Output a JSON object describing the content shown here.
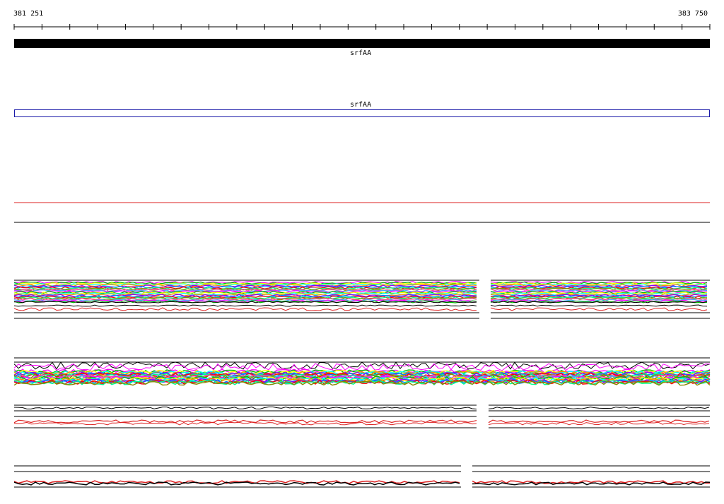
{
  "coordinates": {
    "start": "381 251",
    "end": "383 750"
  },
  "genes": [
    {
      "label": "srfAA",
      "track": "feature"
    },
    {
      "label": "srfAA",
      "track": "outline"
    }
  ],
  "colors": {
    "feature_bar": "#000000",
    "outline_box": "#1a1aa8",
    "red_line": "#dd2222",
    "axis": "#000000",
    "profile_palette": [
      "#ff00ff",
      "#00c000",
      "#ffff00",
      "#00ffff",
      "#ff8800",
      "#8800ff",
      "#0088ff",
      "#ff0000",
      "#00ff88",
      "#888800",
      "#ff44aa",
      "#44aaff"
    ]
  },
  "icons": {
    "gene_feature": "solid-black-bar",
    "gene_outline": "blue-outline-box"
  }
}
